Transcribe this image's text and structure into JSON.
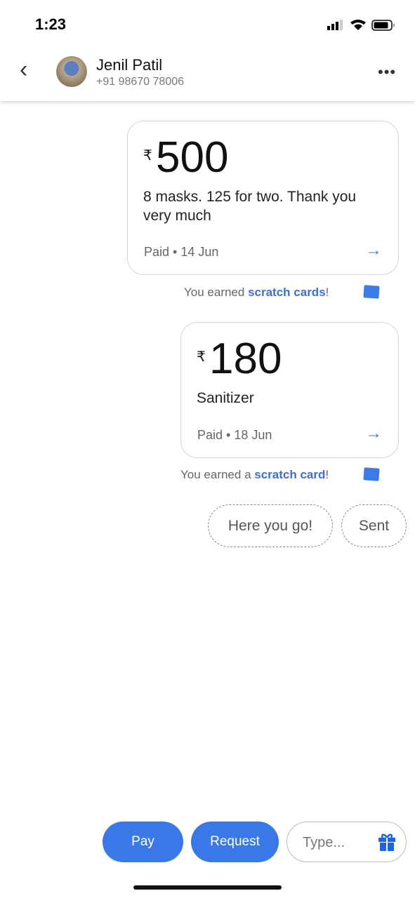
{
  "status": {
    "time": "1:23"
  },
  "header": {
    "name": "Jenil Patil",
    "phone": "+91 98670 78006",
    "back_icon": "chevron-left-icon",
    "more_icon": "more-horizontal-icon"
  },
  "payments": [
    {
      "currency": "₹",
      "amount": "500",
      "note": "8 masks. 125 for two. Thank you very much",
      "status": "Paid • 14 Jun",
      "reward_prefix": "You earned ",
      "reward_link": "scratch cards",
      "reward_suffix": "!"
    },
    {
      "currency": "₹",
      "amount": "180",
      "note": "Sanitizer",
      "status": "Paid • 18 Jun",
      "reward_prefix": "You earned a ",
      "reward_link": "scratch card",
      "reward_suffix": "!"
    }
  ],
  "suggestions": [
    "Here you go!",
    "Sent"
  ],
  "bottom": {
    "pay": "Pay",
    "request": "Request",
    "type_placeholder": "Type...",
    "gift_icon": "gift-icon"
  },
  "colors": {
    "accent": "#3b78e7"
  }
}
